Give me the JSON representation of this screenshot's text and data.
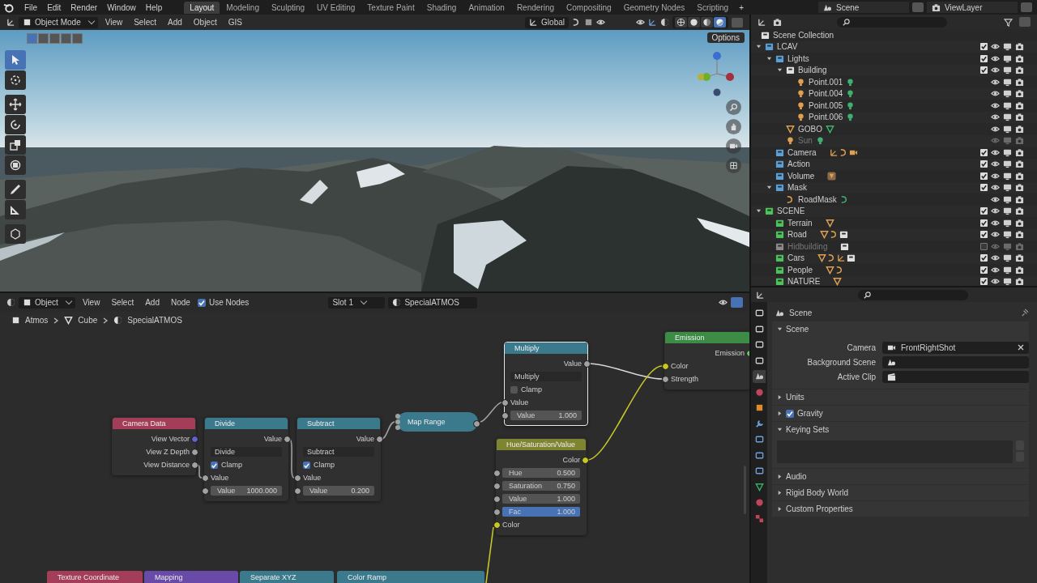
{
  "top_bar": {
    "menus": [
      "File",
      "Edit",
      "Render",
      "Window",
      "Help"
    ],
    "workspaces": [
      {
        "label": "Layout",
        "selected": true
      },
      {
        "label": "Modeling",
        "selected": false
      },
      {
        "label": "Sculpting",
        "selected": false
      },
      {
        "label": "UV Editing",
        "selected": false
      },
      {
        "label": "Texture Paint",
        "selected": false
      },
      {
        "label": "Shading",
        "selected": false
      },
      {
        "label": "Animation",
        "selected": false
      },
      {
        "label": "Rendering",
        "selected": false
      },
      {
        "label": "Compositing",
        "selected": false
      },
      {
        "label": "Geometry Nodes",
        "selected": false
      },
      {
        "label": "Scripting",
        "selected": false
      }
    ],
    "add_workspace": "+",
    "scene": "Scene",
    "view_layer": "ViewLayer"
  },
  "viewport": {
    "mode": "Object Mode",
    "menus": [
      "View",
      "Select",
      "Add",
      "Object",
      "GIS"
    ],
    "orientation": "Global",
    "options": "Options",
    "shading_modes": [
      {
        "kind": "wireframe",
        "selected": false
      },
      {
        "kind": "solid",
        "selected": false
      },
      {
        "kind": "material",
        "selected": false
      },
      {
        "kind": "rendered",
        "selected": true
      }
    ],
    "tools": [
      {
        "kind": "select",
        "selected": true
      },
      {
        "kind": "cursor",
        "selected": false
      },
      {
        "kind": "move",
        "selected": false
      },
      {
        "kind": "rotate",
        "selected": false
      },
      {
        "kind": "scale",
        "selected": false
      },
      {
        "kind": "transform",
        "selected": false
      },
      {
        "kind": "annotate",
        "selected": false
      },
      {
        "kind": "measure",
        "selected": false
      },
      {
        "kind": "add_cube",
        "selected": false
      }
    ]
  },
  "node_editor": {
    "type": "Object",
    "menus": [
      "View",
      "Select",
      "Add",
      "Node"
    ],
    "use_nodes": {
      "label": "Use Nodes",
      "checked": true
    },
    "slot": "Slot 1",
    "material": "SpecialATMOS",
    "breadcrumbs": [
      {
        "kind": "object",
        "label": "Atmos"
      },
      {
        "kind": "mesh",
        "label": "Cube"
      },
      {
        "kind": "material",
        "label": "SpecialATMOS"
      }
    ],
    "nodes": [
      {
        "kind": "node",
        "title": "Camera Data",
        "color": "#a33d58",
        "selected": false,
        "rows": [
          {
            "kind": "output",
            "label": "View Vector",
            "color": "#6363c7"
          },
          {
            "kind": "output",
            "label": "View Z Depth",
            "color": "#a1a1a1"
          },
          {
            "kind": "output",
            "label": "View Distance",
            "color": "#a1a1a1"
          }
        ]
      },
      {
        "kind": "node",
        "title": "Divide",
        "color": "#3a7a8c",
        "selected": false,
        "rows": [
          {
            "kind": "output",
            "label": "Value",
            "color": "#a1a1a1"
          },
          {
            "kind": "dropdown",
            "label": "Divide"
          },
          {
            "kind": "checkbox",
            "label": "Clamp",
            "checked": true
          },
          {
            "kind": "input",
            "label": "Value",
            "color": "#a1a1a1"
          },
          {
            "kind": "field",
            "label": "Value",
            "value": "1000.000",
            "color": "#a1a1a1"
          }
        ]
      },
      {
        "kind": "node",
        "title": "Subtract",
        "color": "#3a7a8c",
        "selected": false,
        "rows": [
          {
            "kind": "output",
            "label": "Value",
            "color": "#a1a1a1"
          },
          {
            "kind": "dropdown",
            "label": "Subtract"
          },
          {
            "kind": "checkbox",
            "label": "Clamp",
            "checked": true
          },
          {
            "kind": "input",
            "label": "Value",
            "color": "#a1a1a1"
          },
          {
            "kind": "field",
            "label": "Value",
            "value": "0.200",
            "color": "#a1a1a1"
          }
        ]
      },
      {
        "kind": "collapsed",
        "title": "Map Range",
        "color": "#3a7a8c",
        "selected": false
      },
      {
        "kind": "node",
        "title": "Multiply",
        "color": "#3a7a8c",
        "selected": true,
        "rows": [
          {
            "kind": "output",
            "label": "Value",
            "color": "#a1a1a1"
          },
          {
            "kind": "dropdown",
            "label": "Multiply"
          },
          {
            "kind": "checkbox",
            "label": "Clamp",
            "checked": false
          },
          {
            "kind": "input",
            "label": "Value",
            "color": "#a1a1a1"
          },
          {
            "kind": "field",
            "label": "Value",
            "value": "1.000",
            "color": "#a1a1a1"
          }
        ]
      },
      {
        "kind": "node",
        "title": "Hue/Saturation/Value",
        "color": "#7f8430",
        "selected": false,
        "rows": [
          {
            "kind": "output",
            "label": "Color",
            "color": "#c7c729"
          },
          {
            "kind": "field",
            "label": "Hue",
            "value": "0.500",
            "color": "#a1a1a1"
          },
          {
            "kind": "field",
            "label": "Saturation",
            "value": "0.750",
            "color": "#a1a1a1"
          },
          {
            "kind": "field",
            "label": "Value",
            "value": "1.000",
            "color": "#a1a1a1"
          },
          {
            "kind": "slider",
            "label": "Fac",
            "value": "1.000",
            "color": "#a1a1a1",
            "level": 1
          },
          {
            "kind": "input",
            "label": "Color",
            "color": "#c7c729"
          }
        ]
      },
      {
        "kind": "node",
        "title": "Emission",
        "color": "#3c8c46",
        "selected": false,
        "rows": [
          {
            "kind": "output",
            "label": "Emission",
            "color": "#63c763"
          },
          {
            "kind": "input",
            "label": "Color",
            "color": "#c7c729"
          },
          {
            "kind": "input",
            "label": "Strength",
            "color": "#a1a1a1"
          }
        ]
      },
      {
        "kind": "node",
        "title": "Texture Coordinate",
        "color": "#a33d58",
        "selected": false
      },
      {
        "kind": "node",
        "title": "Mapping",
        "color": "#6a4aa8",
        "selected": false
      },
      {
        "kind": "node",
        "title": "Separate XYZ",
        "color": "#3a7a8c",
        "selected": false
      },
      {
        "kind": "node",
        "title": "Color Ramp",
        "color": "#3a7a8c",
        "selected": false
      }
    ]
  },
  "outliner": {
    "root": "Scene Collection",
    "items": [
      {
        "label": "LCAV",
        "kind": "collection",
        "color": "#5a9fd6",
        "checked": true,
        "visible": true,
        "expanded": true,
        "children": [
          {
            "label": "Lights",
            "kind": "collection",
            "color": "#5a9fd6",
            "checked": true,
            "visible": true,
            "expanded": true,
            "children": [
              {
                "label": "Building",
                "kind": "collection",
                "color": "#e0e0e0",
                "checked": true,
                "visible": true,
                "expanded": true,
                "children": [
                  {
                    "label": "Point.001",
                    "kind": "light",
                    "data": {
                      "kind": "light"
                    },
                    "visible": true
                  },
                  {
                    "label": "Point.004",
                    "kind": "light",
                    "data": {
                      "kind": "light"
                    },
                    "visible": true
                  },
                  {
                    "label": "Point.005",
                    "kind": "light",
                    "data": {
                      "kind": "light"
                    },
                    "visible": true
                  },
                  {
                    "label": "Point.006",
                    "kind": "light",
                    "data": {
                      "kind": "light"
                    },
                    "visible": true
                  }
                ]
              },
              {
                "label": "GOBO",
                "kind": "mesh",
                "data": {
                  "kind": "mesh"
                },
                "visible": true
              },
              {
                "label": "Sun",
                "kind": "light",
                "data": {
                  "kind": "light"
                },
                "visible": false
              }
            ]
          },
          {
            "label": "Camera",
            "kind": "collection",
            "color": "#5a9fd6",
            "checked": true,
            "visible": true,
            "contents": [
              {
                "kind": "empty"
              },
              {
                "kind": "curve"
              },
              {
                "kind": "camera"
              }
            ]
          },
          {
            "label": "Action",
            "kind": "collection",
            "color": "#5a9fd6",
            "checked": true,
            "visible": true
          },
          {
            "label": "Volume",
            "kind": "collection",
            "color": "#5a9fd6",
            "checked": true,
            "visible": true,
            "contents": [
              {
                "kind": "volume"
              }
            ]
          },
          {
            "label": "Mask",
            "kind": "collection",
            "color": "#5a9fd6",
            "checked": true,
            "visible": true,
            "expanded": true,
            "children": [
              {
                "label": "RoadMask",
                "kind": "curve",
                "data": {
                  "kind": "curve"
                },
                "visible": true
              }
            ]
          }
        ]
      },
      {
        "label": "SCENE",
        "kind": "collection",
        "color": "#4cc25a",
        "checked": true,
        "visible": true,
        "expanded": true,
        "children": [
          {
            "label": "Terrain",
            "kind": "collection",
            "color": "#4cc25a",
            "checked": true,
            "visible": true,
            "contents": [
              {
                "kind": "mesh"
              }
            ]
          },
          {
            "label": "Road",
            "kind": "collection",
            "color": "#4cc25a",
            "checked": true,
            "visible": true,
            "contents": [
              {
                "kind": "mesh"
              },
              {
                "kind": "curve"
              },
              {
                "kind": "collection"
              }
            ]
          },
          {
            "label": "Hidbuilding",
            "kind": "collection",
            "color": "#8a8a8a",
            "checked": false,
            "visible": false,
            "contents": [
              {
                "kind": "collection"
              }
            ]
          },
          {
            "label": "Cars",
            "kind": "collection",
            "color": "#4cc25a",
            "checked": true,
            "visible": true,
            "contents": [
              {
                "kind": "mesh"
              },
              {
                "kind": "curve"
              },
              {
                "kind": "empty"
              },
              {
                "kind": "collection"
              }
            ]
          },
          {
            "label": "People",
            "kind": "collection",
            "color": "#4cc25a",
            "checked": true,
            "visible": true,
            "contents": [
              {
                "kind": "mesh"
              },
              {
                "kind": "curve"
              }
            ]
          },
          {
            "label": "NATURE",
            "kind": "collection",
            "color": "#4cc25a",
            "checked": true,
            "visible": true,
            "contents": [
              {
                "kind": "mesh"
              }
            ]
          }
        ]
      }
    ]
  },
  "properties": {
    "context": "Scene",
    "tabs": [
      {
        "kind": "tool",
        "selected": false
      },
      {
        "kind": "render",
        "selected": false
      },
      {
        "kind": "output",
        "selected": false
      },
      {
        "kind": "view_layer",
        "selected": false
      },
      {
        "kind": "scene",
        "selected": true
      },
      {
        "kind": "world",
        "selected": false
      },
      {
        "kind": "object",
        "selected": false
      },
      {
        "kind": "modifiers",
        "selected": false
      },
      {
        "kind": "particles",
        "selected": false
      },
      {
        "kind": "physics",
        "selected": false
      },
      {
        "kind": "constraints",
        "selected": false
      },
      {
        "kind": "data",
        "selected": false
      },
      {
        "kind": "material",
        "selected": false
      },
      {
        "kind": "texture",
        "selected": false
      }
    ],
    "panels": [
      {
        "kind": "fields",
        "title": "Scene",
        "expanded": true,
        "fields": [
          {
            "label": "Camera",
            "kind": "camera",
            "value": "FrontRightShot"
          },
          {
            "label": "Background Scene",
            "kind": "scene"
          },
          {
            "label": "Active Clip",
            "kind": "clip"
          }
        ]
      },
      {
        "kind": "plain",
        "title": "Units",
        "expanded": false
      },
      {
        "kind": "toggle",
        "title": "Gravity",
        "expanded": false,
        "checked": true
      },
      {
        "kind": "list",
        "title": "Keying Sets",
        "expanded": true
      },
      {
        "kind": "plain",
        "title": "Audio",
        "expanded": false
      },
      {
        "kind": "plain",
        "title": "Rigid Body World",
        "expanded": false
      },
      {
        "kind": "plain",
        "title": "Custom Properties",
        "expanded": false
      }
    ]
  }
}
